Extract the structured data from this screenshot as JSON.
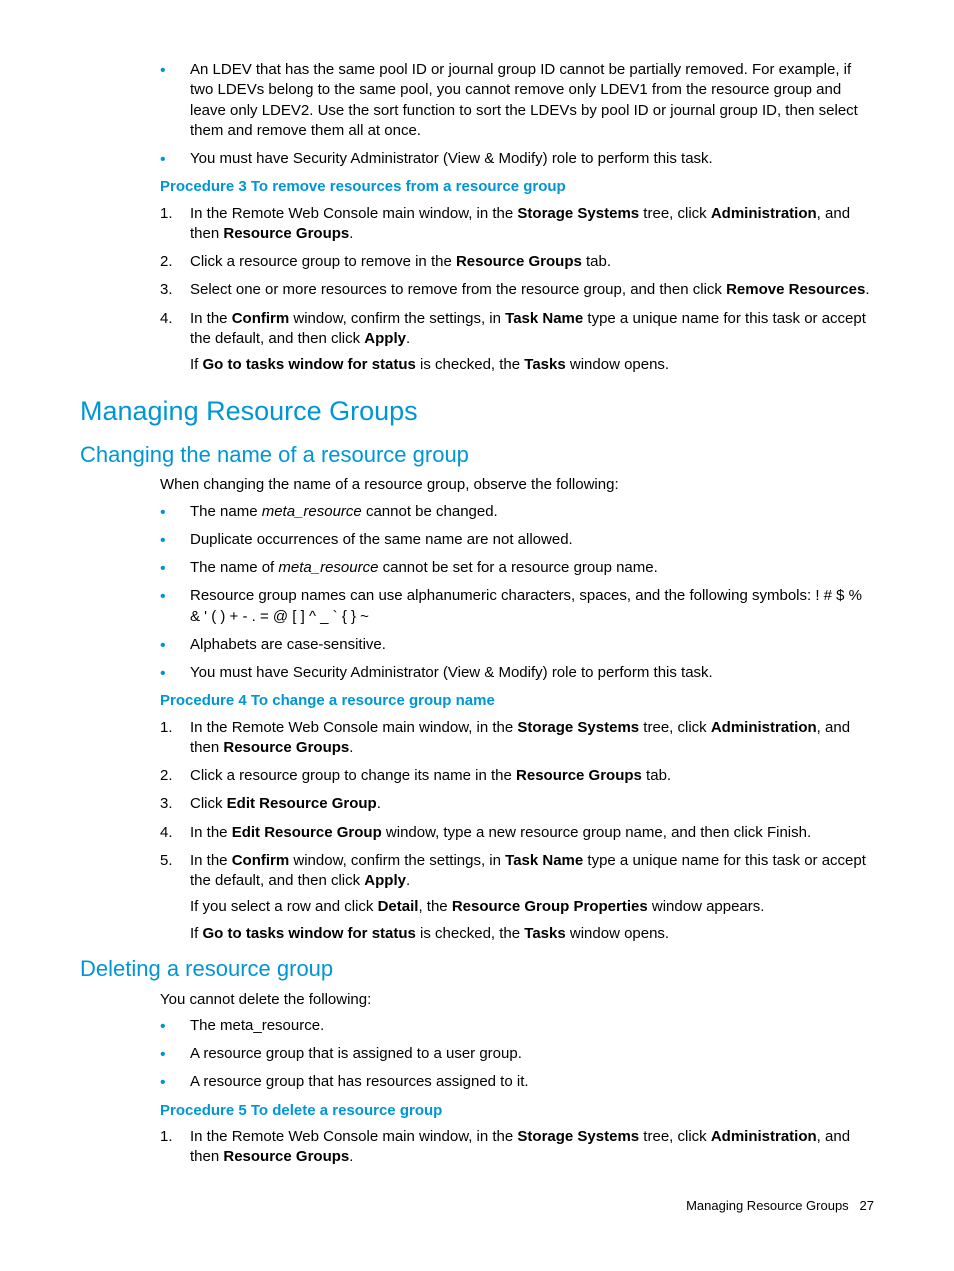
{
  "top_bullets": [
    "An LDEV that has the same pool ID or journal group ID cannot be partially removed. For example, if two LDEVs belong to the same pool, you cannot remove only LDEV1 from the resource group and leave only LDEV2. Use the sort function to sort the LDEVs by pool ID or journal group ID, then select them and remove them all at once.",
    "You must have Security Administrator (View & Modify) role to perform this task."
  ],
  "proc3": {
    "title": "Procedure 3 To remove resources from a resource group",
    "steps": [
      {
        "pre": "In the Remote Web Console main window, in the ",
        "b1": "Storage Systems",
        "mid": " tree, click ",
        "b2": "Administration",
        "mid2": ", and then ",
        "b3": "Resource Groups",
        "post": "."
      },
      {
        "pre": "Click a resource group to remove in the ",
        "b1": "Resource Groups",
        "post": " tab."
      },
      {
        "pre": "Select one or more resources to remove from the resource group, and then click ",
        "b1": "Remove Resources",
        "post": "."
      },
      {
        "pre": "In the ",
        "b1": "Confirm",
        "mid": " window, confirm the settings, in ",
        "b2": "Task Name",
        "mid2": " type a unique name for this task or accept the default, and then click ",
        "b3": "Apply",
        "post": ".",
        "extra": [
          {
            "pre": "If ",
            "b1": "Go to tasks window for status",
            "mid": " is checked, the ",
            "b2": "Tasks",
            "post": " window opens."
          }
        ]
      }
    ]
  },
  "h1": "Managing Resource Groups",
  "h2a": "Changing the name of a resource group",
  "intro_a": "When changing the name of a resource group, observe the following:",
  "bullets_a": [
    {
      "pre": "The name ",
      "em": "meta_resource",
      "post": " cannot be changed."
    },
    {
      "plain": "Duplicate occurrences of the same name are not allowed."
    },
    {
      "pre": "The name of ",
      "em": "meta_resource",
      "post": " cannot be set for a resource group name."
    },
    {
      "plain": "Resource group names can use alphanumeric characters, spaces, and the following symbols: ! # $ % & ' ( ) + - . = @ [ ] ^ _ ` { } ~"
    },
    {
      "plain": "Alphabets are case-sensitive."
    },
    {
      "plain": "You must have Security Administrator (View & Modify) role to perform this task."
    }
  ],
  "proc4": {
    "title": "Procedure 4 To change a resource group name",
    "steps": [
      {
        "pre": "In the Remote Web Console main window, in the ",
        "b1": "Storage Systems",
        "mid": " tree, click ",
        "b2": "Administration",
        "mid2": ", and then ",
        "b3": "Resource Groups",
        "post": "."
      },
      {
        "pre": "Click a resource group to change its name in the ",
        "b1": "Resource Groups",
        "post": " tab."
      },
      {
        "pre": "Click ",
        "b1": "Edit Resource Group",
        "post": "."
      },
      {
        "pre": "In the ",
        "b1": "Edit Resource Group",
        "post": " window, type a new resource group name, and then click Finish."
      },
      {
        "pre": "In the ",
        "b1": "Confirm",
        "mid": " window, confirm the settings, in ",
        "b2": "Task Name",
        "mid2": " type a unique name for this task or accept the default, and then click ",
        "b3": "Apply",
        "post": ".",
        "extra": [
          {
            "pre": "If you select a row and click ",
            "b1": "Detail",
            "mid": ", the ",
            "b2": "Resource Group Properties",
            "post": " window appears."
          },
          {
            "pre": "If ",
            "b1": "Go to tasks window for status",
            "mid": " is checked, the ",
            "b2": "Tasks",
            "post": " window opens."
          }
        ]
      }
    ]
  },
  "h2b": "Deleting a resource group",
  "intro_b": "You cannot delete the following:",
  "bullets_b": [
    "The meta_resource.",
    "A resource group that is assigned to a user group.",
    "A resource group that has resources assigned to it."
  ],
  "proc5": {
    "title": "Procedure 5 To delete a resource group",
    "steps": [
      {
        "pre": "In the Remote Web Console main window, in the ",
        "b1": "Storage Systems",
        "mid": " tree, click ",
        "b2": "Administration",
        "mid2": ", and then ",
        "b3": "Resource Groups",
        "post": "."
      }
    ]
  },
  "footer_text": "Managing Resource Groups",
  "footer_page": "27"
}
